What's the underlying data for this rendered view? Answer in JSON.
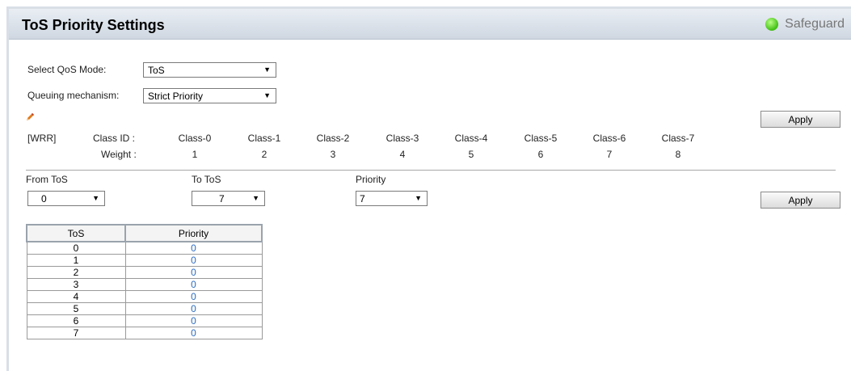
{
  "header": {
    "title": "ToS Priority Settings",
    "safeguard": "Safeguard"
  },
  "qos_mode": {
    "label": "Select QoS Mode:",
    "value": "ToS"
  },
  "queuing": {
    "label": "Queuing mechanism:",
    "value": "Strict Priority"
  },
  "wrr": {
    "tag": "[WRR]",
    "class_id_label": "Class ID :",
    "weight_label": "Weight :",
    "classes": [
      "Class-0",
      "Class-1",
      "Class-2",
      "Class-3",
      "Class-4",
      "Class-5",
      "Class-6",
      "Class-7"
    ],
    "weights": [
      "1",
      "2",
      "3",
      "4",
      "5",
      "6",
      "7",
      "8"
    ]
  },
  "apply_top": "Apply",
  "range": {
    "from_label": "From ToS",
    "from_value": "0",
    "to_label": "To ToS",
    "to_value": "7",
    "priority_label": "Priority",
    "priority_value": "7"
  },
  "apply_range": "Apply",
  "table": {
    "headers": [
      "ToS",
      "Priority"
    ],
    "rows": [
      [
        "0",
        "0"
      ],
      [
        "1",
        "0"
      ],
      [
        "2",
        "0"
      ],
      [
        "3",
        "0"
      ],
      [
        "4",
        "0"
      ],
      [
        "5",
        "0"
      ],
      [
        "6",
        "0"
      ],
      [
        "7",
        "0"
      ]
    ]
  }
}
